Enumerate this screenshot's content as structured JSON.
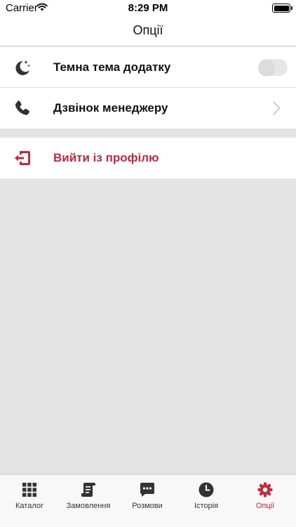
{
  "status_bar": {
    "carrier": "Carrier",
    "time": "8:29 PM"
  },
  "nav": {
    "title": "Опції"
  },
  "settings": {
    "dark_theme": {
      "label": "Темна тема додатку",
      "enabled": false,
      "icon": "moon-stars-icon"
    },
    "manager_call": {
      "label": "Дзвінок менеджеру",
      "icon": "phone-icon"
    },
    "logout": {
      "label": "Вийти із профілю",
      "icon": "logout-icon"
    }
  },
  "tab_bar": {
    "tabs": [
      {
        "label": "Каталог",
        "icon": "grid-icon"
      },
      {
        "label": "Замовлення",
        "icon": "receipt-icon"
      },
      {
        "label": "Розмови",
        "icon": "chat-icon"
      },
      {
        "label": "Історія",
        "icon": "clock-icon"
      },
      {
        "label": "Опції",
        "icon": "gear-icon"
      }
    ],
    "active": "Опції"
  },
  "colors": {
    "accent": "#c8283a",
    "icon": "#333333",
    "background": "#e4e4e4"
  }
}
